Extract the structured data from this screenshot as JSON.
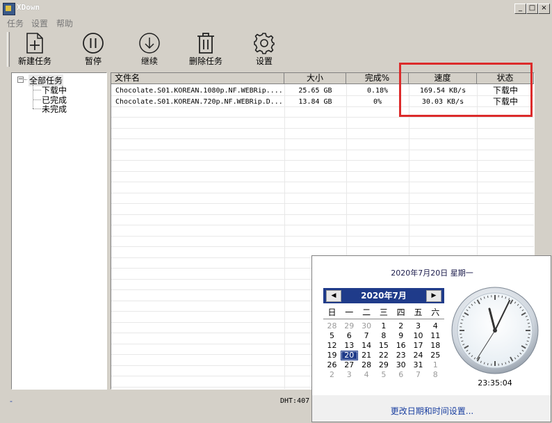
{
  "window": {
    "title": "XDown",
    "min_glyph": "_",
    "max_glyph": "□",
    "close_glyph": "×"
  },
  "menu": [
    {
      "label": "任务"
    },
    {
      "label": "设置"
    },
    {
      "label": "帮助"
    }
  ],
  "toolbar": [
    {
      "label": "新建任务",
      "icon": "new-task-icon"
    },
    {
      "label": "暂停",
      "icon": "pause-icon"
    },
    {
      "label": "继续",
      "icon": "resume-icon"
    },
    {
      "label": "删除任务",
      "icon": "trash-icon"
    },
    {
      "label": "设置",
      "icon": "gear-icon"
    }
  ],
  "tree": {
    "expander": "−",
    "root": "全部任务",
    "children": [
      {
        "label": "下载中"
      },
      {
        "label": "已完成"
      },
      {
        "label": "未完成"
      }
    ]
  },
  "table": {
    "columns": [
      "文件名",
      "大小",
      "完成%",
      "速度",
      "状态"
    ],
    "rows": [
      {
        "name": "Chocolate.S01.KOREAN.1080p.NF.WEBRip....",
        "size": "25.65 GB",
        "done": "0.18%",
        "speed": "169.54 KB/s",
        "status": "下载中"
      },
      {
        "name": "Chocolate.S01.KOREAN.720p.NF.WEBRip.D...",
        "size": "13.84 GB",
        "done": "0%",
        "speed": "30.03 KB/s",
        "status": "下载中"
      }
    ]
  },
  "status": {
    "left": "-",
    "dht": "DHT:407"
  },
  "clock_popup": {
    "date_line": "2020年7月20日  星期一",
    "month_title": "2020年7月",
    "prev": "◀",
    "next": "▶",
    "weekdays": [
      "日",
      "一",
      "二",
      "三",
      "四",
      "五",
      "六"
    ],
    "weeks": [
      [
        "28",
        "29",
        "30",
        "1",
        "2",
        "3",
        "4"
      ],
      [
        "5",
        "6",
        "7",
        "8",
        "9",
        "10",
        "11"
      ],
      [
        "12",
        "13",
        "14",
        "15",
        "16",
        "17",
        "18"
      ],
      [
        "19",
        "20",
        "21",
        "22",
        "23",
        "24",
        "25"
      ],
      [
        "26",
        "27",
        "28",
        "29",
        "30",
        "31",
        "1"
      ],
      [
        "2",
        "3",
        "4",
        "5",
        "6",
        "7",
        "8"
      ]
    ],
    "selected_day": "20",
    "time": "23:35:04",
    "link": "更改日期和时间设置..."
  },
  "colors": {
    "highlight_box": "#dc2b2b",
    "calendar_header": "#1f3b8a"
  }
}
